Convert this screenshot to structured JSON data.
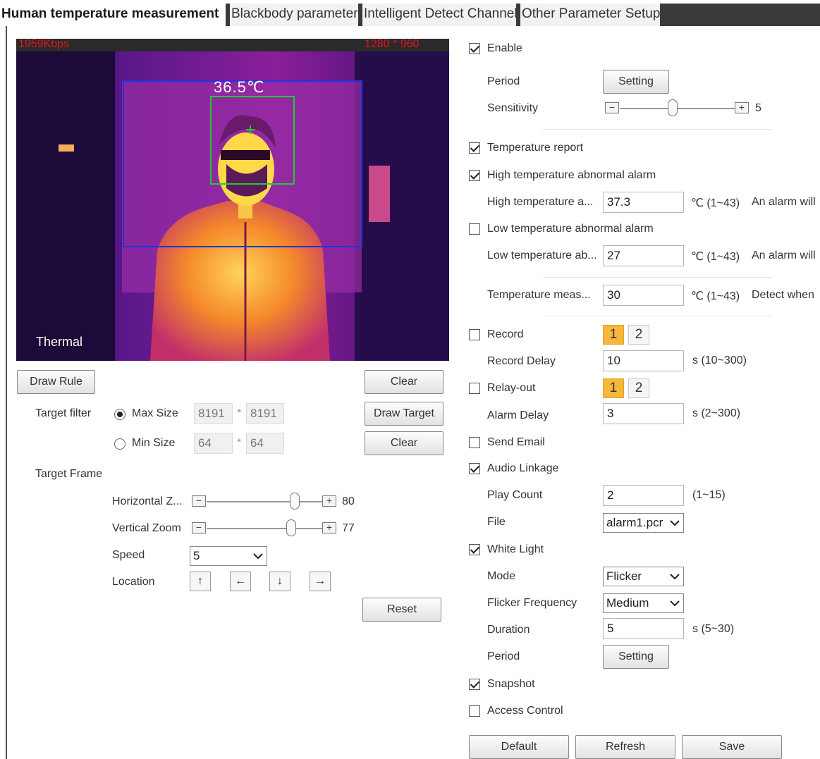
{
  "tabs": [
    {
      "label": "Human temperature measurement"
    },
    {
      "label": "Blackbody parameter"
    },
    {
      "label": "Intelligent Detect Channel"
    },
    {
      "label": "Other Parameter Setup"
    }
  ],
  "video": {
    "bitrate": "1959Kbps",
    "resolution": "1280 * 960",
    "temperature_label": "36.5℃",
    "channel_label": "Thermal"
  },
  "left": {
    "draw_rule": "Draw Rule",
    "clear_1": "Clear",
    "draw_target": "Draw Target",
    "clear_2": "Clear",
    "target_filter_label": "Target filter",
    "max_size_label": "Max Size",
    "max_w": "8191",
    "max_h": "8191",
    "min_size_label": "Min Size",
    "min_w": "64",
    "min_h": "64",
    "times": "*",
    "target_frame_label": "Target Frame",
    "horizontal_zoom_label": "Horizontal Z...",
    "horizontal_zoom_value": "80",
    "vertical_zoom_label": "Vertical Zoom",
    "vertical_zoom_value": "77",
    "speed_label": "Speed",
    "speed_value": "5",
    "location_label": "Location",
    "reset": "Reset"
  },
  "right": {
    "enable": "Enable",
    "period_label": "Period",
    "setting": "Setting",
    "sensitivity_label": "Sensitivity",
    "sensitivity_value": "5",
    "temperature_report": "Temperature report",
    "high_alarm": "High temperature abnormal alarm",
    "high_threshold_label": "High temperature a...",
    "high_threshold_value": "37.3",
    "range_1_43": "℃ (1~43)",
    "high_note": "An alarm will",
    "low_alarm": "Low temperature abnormal alarm",
    "low_threshold_label": "Low temperature ab...",
    "low_threshold_value": "27",
    "low_note": "An alarm will",
    "meas_label": "Temperature meas...",
    "meas_value": "30",
    "meas_note": "Detect when",
    "record": "Record",
    "ch1": "1",
    "ch2": "2",
    "record_delay_label": "Record Delay",
    "record_delay_value": "10",
    "record_delay_range": "s (10~300)",
    "relay_out": "Relay-out",
    "alarm_delay_label": "Alarm Delay",
    "alarm_delay_value": "3",
    "alarm_delay_range": "s (2~300)",
    "send_email": "Send Email",
    "audio_linkage": "Audio Linkage",
    "play_count_label": "Play Count",
    "play_count_value": "2",
    "play_count_range": "(1~15)",
    "file_label": "File",
    "file_value": "alarm1.pcr",
    "white_light": "White Light",
    "mode_label": "Mode",
    "mode_value": "Flicker",
    "flicker_label": "Flicker Frequency",
    "flicker_value": "Medium",
    "duration_label": "Duration",
    "duration_value": "5",
    "duration_range": "s (5~30)",
    "period2_label": "Period",
    "setting2": "Setting",
    "snapshot": "Snapshot",
    "access_control": "Access Control",
    "default": "Default",
    "refresh": "Refresh",
    "save": "Save"
  },
  "colors": {
    "accent_orange": "#f6b73c",
    "osd_red": "#e0161c",
    "tab_dark": "#3a3a3a"
  }
}
